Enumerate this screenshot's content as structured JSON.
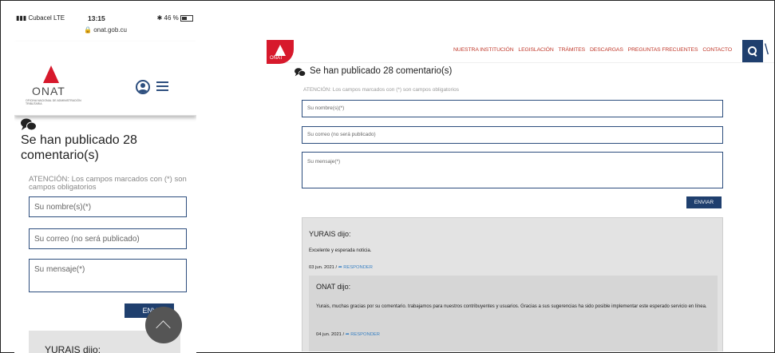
{
  "mobile": {
    "status": {
      "carrier": "Cubacel  LTE",
      "time": "13:15",
      "battery": "46 %"
    },
    "url": "onat.gob.cu",
    "logo_text": "ONAT",
    "logo_subtitle": "OFICINA NACIONAL DE ADMINISTRACIÓN TRIBUTARIA",
    "title": "Se han publicado 28 comentario(s)",
    "attention": "ATENCIÓN: Los campos marcados con (*) son campos obligatorios",
    "name_placeholder": "Su nombre(s)(*)",
    "email_placeholder": "Su correo (no será publicado)",
    "message_placeholder": "Su mensaje(*)",
    "submit_label": "ENVIAR",
    "first_comment_author": "YURAIS dijo:"
  },
  "desktop": {
    "logo_text": "ONAT",
    "nav": [
      "NUESTRA INSTITUCIÓN",
      "LEGISLACIÓN",
      "TRÁMITES",
      "DESCARGAS",
      "PREGUNTAS FRECUENTES",
      "CONTACTO"
    ],
    "title": "Se han publicado 28 comentario(s)",
    "attention": "ATENCIÓN: Los campos marcados con (*) son campos obligatorios",
    "name_placeholder": "Su nombre(s)(*)",
    "email_placeholder": "Su correo (no será publicado)",
    "message_placeholder": "Su mensaje(*)",
    "submit_label": "ENVIAR",
    "comment": {
      "author": "YURAIS dijo:",
      "text": "Excelente y esperada noticia.",
      "date": "03 jun. 2021 /",
      "reply_label": "RESPONDER"
    },
    "reply": {
      "author": "ONAT dijo:",
      "text": "Yurais, muchas gracias por su comentario. trabajamos para nuestros contribuyentes y usuarios. Gracias a sus sugerencias ha sido posible implementar este esperado servicio en línea.",
      "date": "04 jun. 2021 /",
      "reply_label": "RESPONDER"
    }
  },
  "colors": {
    "brand_red": "#d7192c",
    "navy": "#1f3f6e",
    "link_blue": "#3b82c4"
  },
  "icons": [
    "user-icon",
    "hamburger-icon",
    "chat-bubbles-icon",
    "search-icon",
    "reply-arrow-icon",
    "scroll-up-icon"
  ]
}
